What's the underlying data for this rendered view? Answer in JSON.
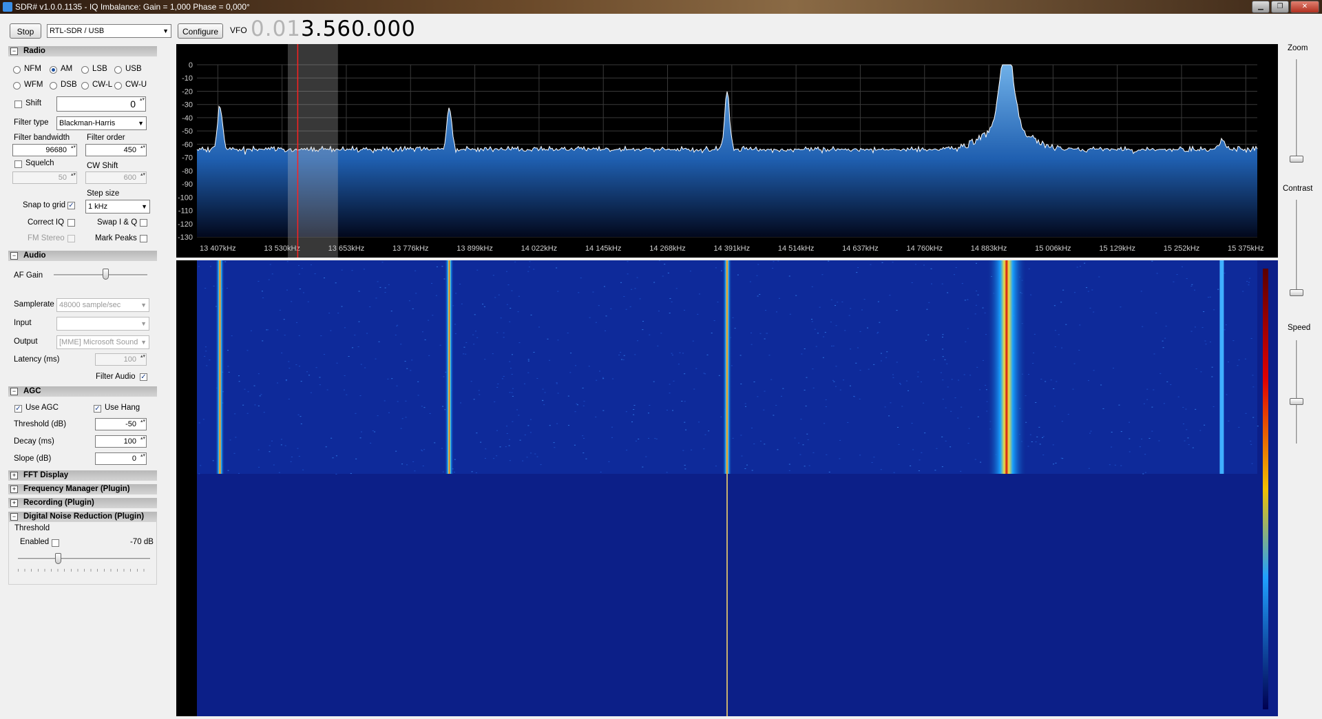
{
  "window": {
    "title": "SDR# v1.0.0.1135 - IQ Imbalance: Gain = 1,000 Phase = 0,000°"
  },
  "toolbar": {
    "stop_label": "Stop",
    "source_value": "RTL-SDR / USB",
    "configure_label": "Configure",
    "vfo_label": "VFO",
    "vfo_dim": "0.01",
    "vfo_main": "3.560.000"
  },
  "radio": {
    "header": "Radio",
    "modes": [
      "NFM",
      "AM",
      "LSB",
      "USB",
      "WFM",
      "DSB",
      "CW-L",
      "CW-U"
    ],
    "selected_mode": "AM",
    "shift_label": "Shift",
    "shift_value": "0",
    "filter_type_label": "Filter type",
    "filter_type_value": "Blackman-Harris",
    "filter_bandwidth_label": "Filter bandwidth",
    "filter_bandwidth_value": "96680",
    "filter_order_label": "Filter order",
    "filter_order_value": "450",
    "squelch_label": "Squelch",
    "squelch_value": "50",
    "cw_shift_label": "CW Shift",
    "cw_shift_value": "600",
    "step_size_label": "Step size",
    "snap_label": "Snap to grid",
    "step_size_value": "1 kHz",
    "correct_iq_label": "Correct IQ",
    "swap_iq_label": "Swap I & Q",
    "fm_stereo_label": "FM Stereo",
    "mark_peaks_label": "Mark Peaks"
  },
  "audio": {
    "header": "Audio",
    "af_gain_label": "AF Gain",
    "af_gain_level": 0.55,
    "samplerate_label": "Samplerate",
    "samplerate_value": "48000 sample/sec",
    "input_label": "Input",
    "input_value": "",
    "output_label": "Output",
    "output_value": "[MME] Microsoft Sound",
    "latency_label": "Latency (ms)",
    "latency_value": "100",
    "filter_audio_label": "Filter Audio"
  },
  "agc": {
    "header": "AGC",
    "use_agc_label": "Use AGC",
    "use_hang_label": "Use Hang",
    "threshold_label": "Threshold (dB)",
    "threshold_value": "-50",
    "decay_label": "Decay (ms)",
    "decay_value": "100",
    "slope_label": "Slope (dB)",
    "slope_value": "0"
  },
  "collapsed_sections": [
    "FFT Display",
    "Frequency Manager (Plugin)",
    "Recording (Plugin)"
  ],
  "dnr": {
    "header": "Digital Noise Reduction (Plugin)",
    "threshold_label": "Threshold",
    "enabled_label": "Enabled",
    "db_value": "-70 dB",
    "slider_level": 0.3
  },
  "right_panel": {
    "zoom_label": "Zoom",
    "contrast_label": "Contrast",
    "speed_label": "Speed",
    "zoom_level": 0.0,
    "contrast_level": 0.0,
    "speed_level": 0.4
  },
  "chart_data": {
    "type": "line",
    "x_unit": "kHz",
    "x_ticks": [
      "13 407kHz",
      "13 530kHz",
      "13 653kHz",
      "13 776kHz",
      "13 899kHz",
      "14 022kHz",
      "14 145kHz",
      "14 268kHz",
      "14 391kHz",
      "14 514kHz",
      "14 637kHz",
      "14 760kHz",
      "14 883kHz",
      "15 006kHz",
      "15 129kHz",
      "15 252kHz",
      "15 375kHz"
    ],
    "y_ticks": [
      "0",
      "-10",
      "-20",
      "-30",
      "-40",
      "-50",
      "-60",
      "-70",
      "-80",
      "-90",
      "-100",
      "-110",
      "-120",
      "-130"
    ],
    "ylim": [
      -130,
      0
    ],
    "xlim": [
      13367,
      15397
    ],
    "noise_floor_db": -66,
    "peaks": [
      {
        "freq_khz": 13411,
        "level_db": -31
      },
      {
        "freq_khz": 13850,
        "level_db": -34
      },
      {
        "freq_khz": 14382,
        "level_db": -21
      },
      {
        "freq_khz": 14917,
        "level_db": -1
      },
      {
        "freq_khz": 15329,
        "level_db": -55
      }
    ],
    "filter_start_khz": 13541,
    "filter_end_khz": 13637,
    "tuned_khz": 13560
  }
}
